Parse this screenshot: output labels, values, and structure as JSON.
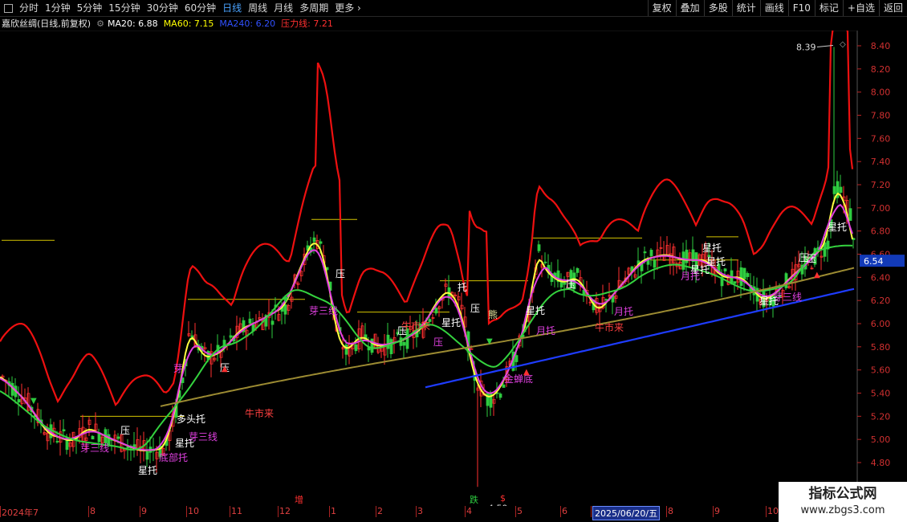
{
  "toolbar": {
    "tabs": [
      "分时",
      "1分钟",
      "5分钟",
      "15分钟",
      "30分钟",
      "60分钟",
      "日线",
      "周线",
      "月线",
      "多周期",
      "更多"
    ],
    "active_tab": "日线",
    "right_tools": [
      "复权",
      "叠加",
      "多股",
      "统计",
      "画线",
      "F10",
      "标记",
      "+自选",
      "返回"
    ]
  },
  "legend": {
    "stock": "嘉欣丝绸(日线,前复权)",
    "ma20": "MA20: 6.88",
    "ma60": "MA60: 7.15",
    "ma240": "MA240: 6.20",
    "pressure": "压力线: 7.21",
    "colors": {
      "ma20": "#ffffff",
      "ma60": "#ffff00",
      "ma240": "#1e3cff",
      "pressure": "#ff2020"
    }
  },
  "yaxis": {
    "ticks": [
      "8.40",
      "8.20",
      "8.00",
      "7.80",
      "7.60",
      "7.40",
      "7.20",
      "7.00",
      "6.80",
      "6.60",
      "6.40",
      "6.20",
      "6.00",
      "5.80",
      "5.60",
      "5.40",
      "5.20",
      "5.00",
      "4.80"
    ],
    "current_price": "6.54",
    "high_label": "8.39",
    "low_label": "4.59"
  },
  "xaxis": {
    "labels": [
      "2024年7",
      "8",
      "9",
      "10",
      "11",
      "12",
      "1",
      "2",
      "3",
      "4",
      "5",
      "6",
      "2025/06/20/五",
      "8",
      "9",
      "10"
    ],
    "markers": {
      "zeng": "增",
      "die": "跌",
      "s": "$"
    }
  },
  "annotations": [
    "芽三线",
    "星托",
    "底部托",
    "星托",
    "芽",
    "压",
    "压",
    "压",
    "压",
    "星托",
    "牛市来",
    "牛市来",
    "多头托",
    "芽三线",
    "压",
    "压",
    "压",
    "压",
    "托",
    "熊",
    "金蝉底",
    "星托",
    "牛市来",
    "星托",
    "月托",
    "月托",
    "星托",
    "芽三线",
    "星托",
    "星托",
    "月托",
    "芽三线",
    "压",
    "星托"
  ],
  "watermark": {
    "title": "指标公式网",
    "url": "www.zbgs3.com"
  },
  "colors": {
    "up": "#ff3030",
    "down": "#2ecc40",
    "ma_green": "#34d23e",
    "ma_olive": "#9c8b32",
    "ma_magenta": "#e040e0",
    "ma_blue": "#1e3cff",
    "pressure": "#ee1010",
    "hline": "#d4c400"
  }
}
